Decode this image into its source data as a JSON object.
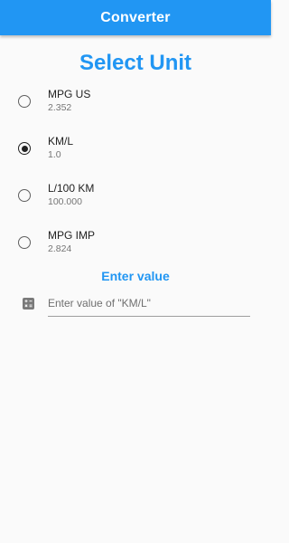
{
  "appbar": {
    "title": "Converter"
  },
  "heading": "Select Unit",
  "options": [
    {
      "label": "MPG US",
      "value": "2.352",
      "selected": false
    },
    {
      "label": "KM/L",
      "value": "1.0",
      "selected": true
    },
    {
      "label": "L/100 KM",
      "value": "100.000",
      "selected": false
    },
    {
      "label": "MPG IMP",
      "value": "2.824",
      "selected": false
    }
  ],
  "enter": {
    "title": "Enter value",
    "placeholder": "Enter value of \"KM/L\"",
    "icon": "calculator-icon"
  },
  "colors": {
    "accent": "#2196f3",
    "background": "#fafafa"
  }
}
